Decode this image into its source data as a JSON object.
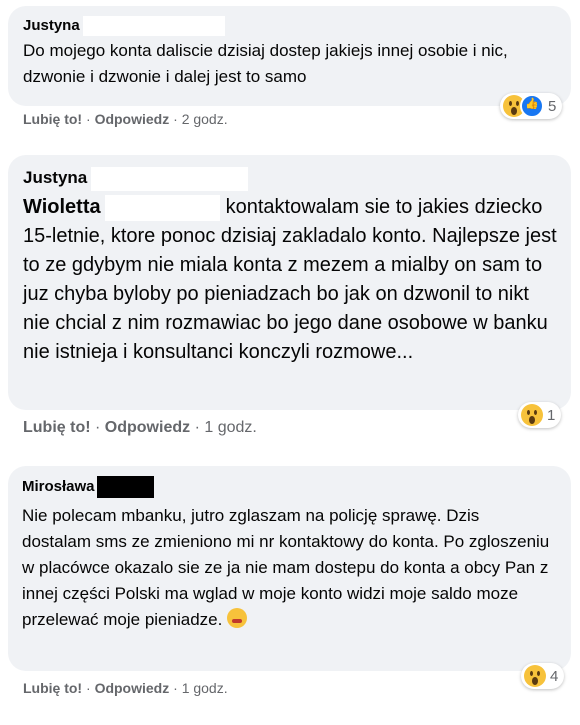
{
  "comments": [
    {
      "author": "Justyna",
      "text": "Do mojego konta daliscie dzisiaj dostep jakiejs innej osobie i nic, dzwonie i dzwonie i dalej jest to samo",
      "like_label": "Lubię to!",
      "reply_label": "Odpowiedz",
      "time": "2 godz.",
      "reaction_count": "5",
      "reactions": [
        "wow-icon",
        "like-icon"
      ]
    },
    {
      "author": "Justyna",
      "mention": "Wioletta",
      "text": "kontaktowalam sie to jakies dziecko 15-letnie, ktore ponoc dzisiaj zakladalo konto. Najlepsze jest to ze gdybym nie miala konta z mezem a mialby on sam to juz chyba byloby po pieniadzach bo jak on dzwonil to nikt nie chcial z nim rozmawiac bo jego dane osobowe w banku nie istnieja i konsultanci konczyli rozmowe...",
      "like_label": "Lubię to!",
      "reply_label": "Odpowiedz",
      "time": "1 godz.",
      "reaction_count": "1",
      "reactions": [
        "wow-icon"
      ]
    },
    {
      "author": "Mirosława",
      "text": "Nie polecam mbanku, jutro zglaszam na policję sprawę. Dzis dostalam sms ze zmieniono mi nr kontaktowy do konta. Po zgloszeniu w placówce okazalo sie ze ja nie mam dostepu do konta a obcy Pan z innej części Polski ma wglad w moje konto widzi moje saldo moze przelewać moje pieniadze.",
      "like_label": "Lubię to!",
      "reply_label": "Odpowiedz",
      "time": "1 godz.",
      "reaction_count": "4",
      "reactions": [
        "wow-icon"
      ]
    }
  ],
  "separator": "·"
}
